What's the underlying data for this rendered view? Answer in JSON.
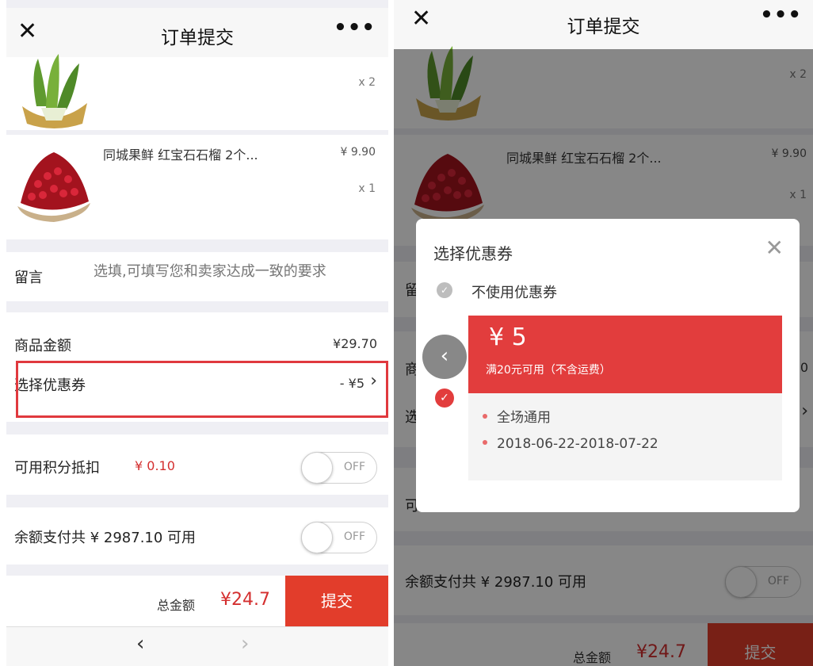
{
  "topbar": {
    "title": "订单提交",
    "close_glyph": "✕",
    "more_glyph": "•••"
  },
  "items": [
    {
      "name": "",
      "price": "",
      "qty": "x 2",
      "image": "bok-choy"
    },
    {
      "name": "同城果鲜 红宝石石榴 2个...",
      "price": "¥ 9.90",
      "qty": "x 1",
      "image": "pomegranate"
    }
  ],
  "message": {
    "label": "留言",
    "placeholder": "选填,可填写您和卖家达成一致的要求"
  },
  "summary": {
    "goods_label": "商品金额",
    "goods_value": "¥29.70",
    "coupon_label": "选择优惠券",
    "coupon_value": "- ¥5",
    "coupon_chevron": "›"
  },
  "points": {
    "label": "可用积分抵扣",
    "value": "¥ 0.10",
    "toggle": "OFF"
  },
  "balance": {
    "label": "余额支付共 ¥ 2987.10 可用",
    "toggle": "OFF"
  },
  "footer": {
    "total_label": "总金额",
    "total_value": "¥24.7",
    "submit_label": "提交"
  },
  "nav": {
    "back": "‹",
    "forward": "›"
  },
  "coupon_modal": {
    "title": "选择优惠券",
    "close_glyph": "✕",
    "no_coupon_label": "不使用优惠券",
    "prev_glyph": "‹",
    "check_glyph": "✓",
    "coupon": {
      "amount": "¥  5",
      "condition": "满20元可用（不含运费）",
      "details": [
        "全场通用",
        "2018-06-22-2018-07-22"
      ]
    }
  },
  "right_partial": {
    "message_char": "留",
    "goods_char": "商",
    "coupon_char": "选",
    "points_char": "可",
    "goods_value_partial": "0",
    "chevron": "›"
  },
  "colors": {
    "accent_red": "#e23d2b",
    "price_red": "#d42f2f",
    "background": "#efeff4"
  }
}
